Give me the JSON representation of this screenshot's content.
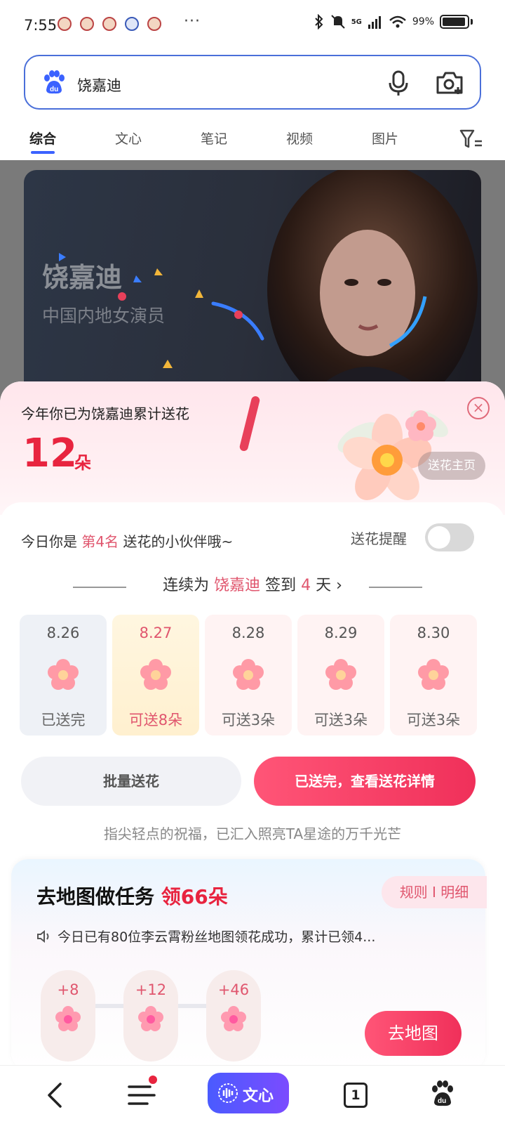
{
  "status_bar": {
    "time": "7:55",
    "more": "···",
    "network": "5G",
    "battery": "99%"
  },
  "search": {
    "query": "饶嘉迪"
  },
  "tabs": [
    {
      "label": "综合",
      "active": true
    },
    {
      "label": "文心",
      "active": false
    },
    {
      "label": "笔记",
      "active": false
    },
    {
      "label": "视频",
      "active": false
    },
    {
      "label": "图片",
      "active": false
    }
  ],
  "hero": {
    "name": "饶嘉迪",
    "subtitle": "中国内地女演员"
  },
  "flower_sheet": {
    "header_text": "今年你已为饶嘉迪累计送花",
    "count": "12",
    "count_unit": "朵",
    "home_button": "送花主页",
    "close_icon": "close-icon",
    "rank_prefix": "今日你是 ",
    "rank": "第4名",
    "rank_suffix": " 送花的小伙伴哦~",
    "reminder_label": "送花提醒",
    "reminder_on": false,
    "streak_prefix": "连续为 ",
    "streak_name": "饶嘉迪",
    "streak_mid": " 签到 ",
    "streak_days": "4",
    "streak_suffix": " 天",
    "days": [
      {
        "date": "8.26",
        "status": "已送完",
        "style": "done"
      },
      {
        "date": "8.27",
        "status": "可送8朵",
        "style": "today"
      },
      {
        "date": "8.28",
        "status": "可送3朵",
        "style": "future"
      },
      {
        "date": "8.29",
        "status": "可送3朵",
        "style": "future"
      },
      {
        "date": "8.30",
        "status": "可送3朵",
        "style": "future"
      }
    ],
    "batch_button": "批量送花",
    "detail_button": "已送完，查看送花详情",
    "blessing": "指尖轻点的祝福，已汇入照亮TA星途的万千光芒"
  },
  "task_card": {
    "title": "去地图做任务 ",
    "reward": "领66朵",
    "rules": "规则 I 明细",
    "notice": "今日已有80位李云霄粉丝地图领花成功，累计已领4...",
    "bonuses": [
      "+8",
      "+12",
      "+46"
    ],
    "go_button": "去地图"
  },
  "bottom_nav": {
    "wenxin_label": "文心",
    "tab_count": "1"
  },
  "colors": {
    "accent_red": "#e8243f",
    "accent_pink": "#e0566e",
    "search_border": "#4a6fd9",
    "tab_underline": "#3b62ff"
  }
}
